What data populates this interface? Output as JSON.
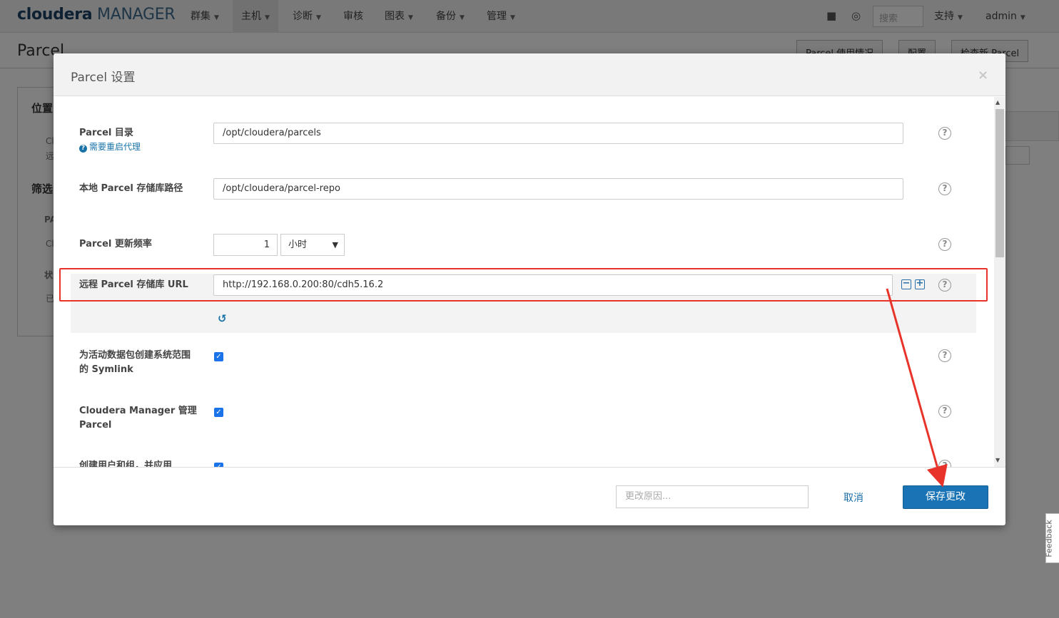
{
  "app": {
    "logo_main": "cloudera",
    "logo_sub": "MANAGER",
    "nav": [
      {
        "label": "群集"
      },
      {
        "label": "主机"
      },
      {
        "label": "诊断"
      },
      {
        "label": "审核"
      },
      {
        "label": "图表"
      },
      {
        "label": "备份"
      },
      {
        "label": "管理"
      }
    ],
    "search_placeholder": "搜索",
    "support_label": "支持",
    "user_label": "admin",
    "icons": [
      "briefcase-icon",
      "user-search-icon"
    ]
  },
  "page": {
    "title": "Parcel",
    "buttons": [
      "Parcel 使用情况",
      "配置",
      "检查新 Parcel"
    ],
    "left_headings": [
      "位置",
      "筛选"
    ],
    "left_texts": [
      "Cl",
      "远",
      "PA",
      "Cl",
      "状",
      "已"
    ]
  },
  "modal": {
    "title": "Parcel 设置",
    "rows": {
      "parcel_dir": {
        "label": "Parcel 目录",
        "note": "需要重启代理",
        "value": "/opt/cloudera/parcels"
      },
      "local_repo": {
        "label": "本地 Parcel 存储库路径",
        "value": "/opt/cloudera/parcel-repo"
      },
      "update_freq": {
        "label": "Parcel 更新频率",
        "value": "1",
        "unit": "小时"
      },
      "remote_url": {
        "label": "远程 Parcel 存储库 URL",
        "value": "http://192.168.0.200:80/cdh5.16.2"
      },
      "symlink": {
        "label_line1": "为活动数据包创建系统范围",
        "label_line2": "的 Symlink",
        "checked": true
      },
      "cm_manage": {
        "label_line1": "Cloudera Manager 管理",
        "label_line2": "Parcel",
        "checked": true
      },
      "create_users": {
        "label": "创建用户和组，并应用",
        "checked": true
      }
    },
    "footer": {
      "reason_placeholder": "更改原因...",
      "cancel_label": "取消",
      "save_label": "保存更改"
    }
  },
  "feedback_label": "Feedback",
  "colors": {
    "accent": "#1a73b5",
    "annotation_red": "#e8332a",
    "checkbox_blue": "#1a73e8"
  }
}
